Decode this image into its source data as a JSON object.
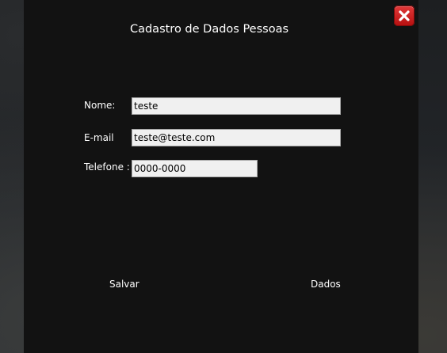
{
  "window": {
    "title": "Cadastro de Dados Pessoas"
  },
  "icons": {
    "close": "close-icon"
  },
  "colors": {
    "window_background": "#121212",
    "close_button": "#d42020",
    "field_background": "#f0f0f0",
    "text": "#ffffff"
  },
  "form": {
    "nome": {
      "label": "Nome:",
      "value": "teste"
    },
    "email": {
      "label": "E-mail",
      "value": "teste@teste.com"
    },
    "telefone": {
      "label": "Telefone :",
      "value": "0000-0000"
    }
  },
  "actions": {
    "salvar": "Salvar",
    "dados": "Dados"
  }
}
